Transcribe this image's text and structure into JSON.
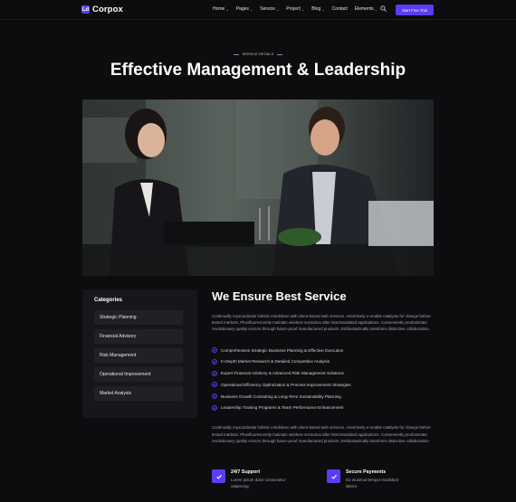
{
  "header": {
    "brand": "Corpox",
    "brand_mark": "Ld",
    "nav": [
      {
        "label": "Home",
        "has_caret": true
      },
      {
        "label": "Pages",
        "has_caret": true
      },
      {
        "label": "Service",
        "has_caret": true
      },
      {
        "label": "Project",
        "has_caret": true
      },
      {
        "label": "Blog",
        "has_caret": true
      },
      {
        "label": "Contact",
        "has_caret": false
      },
      {
        "label": "Elements",
        "has_caret": true
      }
    ],
    "search_icon": "search-icon",
    "cta_label": "Start Free Trial"
  },
  "hero": {
    "eyebrow": "SERVICE DETAILS",
    "title": "Effective Management & Leadership",
    "image_alt": "Two business people working on a laptop"
  },
  "sidebar": {
    "title": "Categories",
    "items": [
      "Strategic Planning",
      "Financial Advisory",
      "Risk Management",
      "Operational Improvement",
      "Market Analysis"
    ]
  },
  "main": {
    "heading": "We Ensure Best Service",
    "paragraph_1": "Continually myocardinate holistic mindshare with client-based web services. Assertively e-enable catalysts for change before tested markets. Phosfluorescently maintain wireless scenarios after intermandated applications. Conveniently predominate revolutionary quality vectors through future-proof manufactured products. Enthusiastically transform distinctive collaboration.",
    "checklist": [
      "Comprehensive Strategic Business Planning & Effective Execution",
      "In-Depth Market Research & Detailed Competitive Analysis",
      "Expert Financial Advisory & Advanced Risk Management Solutions",
      "Operational Efficiency Optimization & Process Improvement Strategies",
      "Business Growth Consulting & Long-Term Sustainability Planning",
      "Leadership Training Programs & Team Performance Enhancement"
    ],
    "paragraph_2": "Continually myocardinate holistic mindshare with client-based web services. Assertively e-enable catalysts for change before tested markets. Phosfluorescently maintain wireless scenarios after intermandated applications. Conveniently predominate revolutionary quality vectors through future-proof manufactured products. Enthusiastically transform distinctive collaboration."
  },
  "features": [
    {
      "title": "24/7 Support",
      "text": "Lorem ipsum dolor consectetur adipiscing",
      "icon": "check-icon"
    },
    {
      "title": "Secure Payments",
      "text": "Do eiusmod tempor incididunt labore.",
      "icon": "check-icon"
    }
  ],
  "colors": {
    "accent": "#5b3df5",
    "background": "#0d0d0f",
    "panel": "#17171b"
  }
}
